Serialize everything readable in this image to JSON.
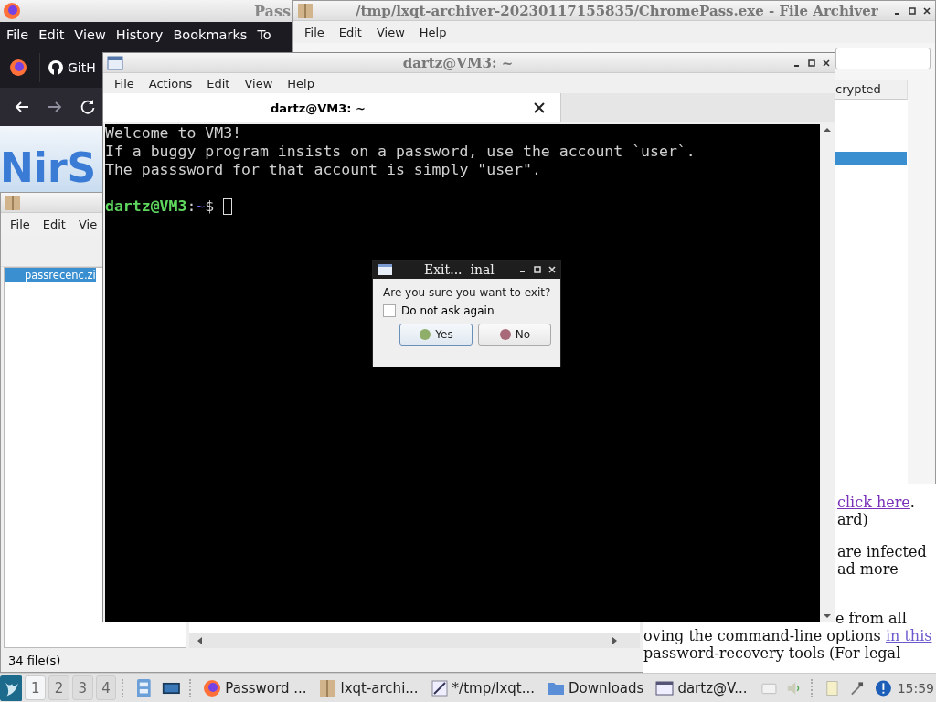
{
  "browser": {
    "title": "Pass",
    "menu": [
      "File",
      "Edit",
      "View",
      "History",
      "Bookmarks",
      "To"
    ],
    "tab": "GitH",
    "logo": "NirS",
    "page_text": [
      [
        {
          "text": "click here",
          "link": true
        },
        {
          "text": ".",
          "link": false
        }
      ],
      [
        {
          "text": "ard)",
          "link": false
        }
      ],
      [
        {
          "text": "are infected",
          "link": false
        }
      ],
      [
        {
          "text": "ad more",
          "link": false
        }
      ],
      [
        {
          "text": "e from all",
          "link": false
        }
      ],
      [
        {
          "text": "oving the command-line options ",
          "link": false
        },
        {
          "text": "in this",
          "link": true
        }
      ],
      [
        {
          "text": "password-recovery tools (For legal",
          "link": false
        }
      ]
    ]
  },
  "archiver": {
    "title": "/tmp/lxqt-archiver-20230117155835/ChromePass.exe - File Archiver",
    "menu": [
      "File",
      "Edit",
      "View",
      "Help"
    ],
    "column": "crypted"
  },
  "file_window": {
    "menu": [
      "File",
      "Edit",
      "Vie"
    ],
    "files": [
      {
        "name": "passrecenc.zi",
        "selected": true
      }
    ],
    "status": "34 file(s)"
  },
  "terminal": {
    "title": "dartz@VM3: ~",
    "menu": [
      "File",
      "Actions",
      "Edit",
      "View",
      "Help"
    ],
    "tab": "dartz@VM3: ~",
    "lines": [
      "Welcome to VM3!",
      "If a buggy program insists on a password, use the account `user`.",
      "The passsword for that account is simply \"user\"."
    ],
    "prompt": {
      "user": "dartz@VM3",
      "separator": ":",
      "path": "~",
      "symbol": "$"
    }
  },
  "dialog": {
    "title": "Exit...  inal",
    "question": "Are you sure you want to exit?",
    "checkbox": {
      "label": "Do not ask again",
      "checked": false
    },
    "buttons": [
      {
        "label": "Yes",
        "kind": "yes",
        "selected": true
      },
      {
        "label": "No",
        "kind": "no",
        "selected": false
      }
    ]
  },
  "taskbar": {
    "desktops": [
      {
        "label": "1",
        "selected": true
      },
      {
        "label": "2",
        "selected": false
      },
      {
        "label": "3",
        "selected": false
      },
      {
        "label": "4",
        "selected": false
      }
    ],
    "tasks": [
      {
        "label": "Password ...",
        "kind": "firefox"
      },
      {
        "label": "lxqt-archi...",
        "kind": "archive"
      },
      {
        "label": "*/tmp/lxqt...",
        "kind": "editor"
      },
      {
        "label": "Downloads",
        "kind": "folder"
      },
      {
        "label": "dartz@V...",
        "kind": "window"
      }
    ],
    "clock": "15:59"
  }
}
